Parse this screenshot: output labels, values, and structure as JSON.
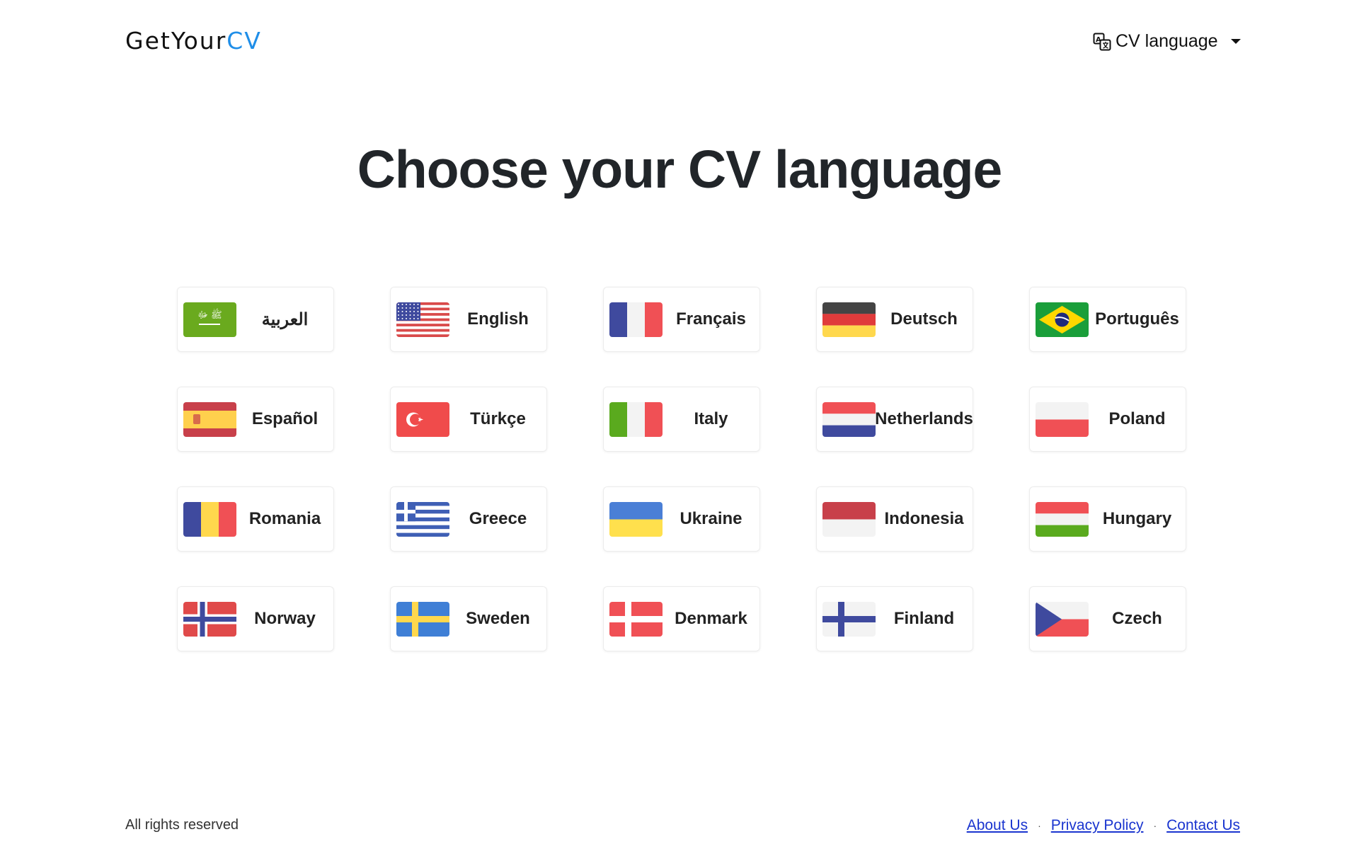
{
  "header": {
    "logo_part1": "GetYour",
    "logo_part2": "CV",
    "language_button_label": "CV language",
    "language_icon": "translate-icon"
  },
  "main": {
    "title": "Choose your CV language",
    "languages": [
      {
        "label": "العربية",
        "flag": "saudi-arabia-flag"
      },
      {
        "label": "English",
        "flag": "usa-flag"
      },
      {
        "label": "Français",
        "flag": "france-flag"
      },
      {
        "label": "Deutsch",
        "flag": "germany-flag"
      },
      {
        "label": "Português",
        "flag": "brazil-flag"
      },
      {
        "label": "Español",
        "flag": "spain-flag"
      },
      {
        "label": "Türkçe",
        "flag": "turkey-flag"
      },
      {
        "label": "Italy",
        "flag": "italy-flag"
      },
      {
        "label": "Netherlands",
        "flag": "netherlands-flag"
      },
      {
        "label": "Poland",
        "flag": "poland-flag"
      },
      {
        "label": "Romania",
        "flag": "romania-flag"
      },
      {
        "label": "Greece",
        "flag": "greece-flag"
      },
      {
        "label": "Ukraine",
        "flag": "ukraine-flag"
      },
      {
        "label": "Indonesia",
        "flag": "indonesia-flag"
      },
      {
        "label": "Hungary",
        "flag": "hungary-flag"
      },
      {
        "label": "Norway",
        "flag": "norway-flag"
      },
      {
        "label": "Sweden",
        "flag": "sweden-flag"
      },
      {
        "label": "Denmark",
        "flag": "denmark-flag"
      },
      {
        "label": "Finland",
        "flag": "finland-flag"
      },
      {
        "label": "Czech",
        "flag": "czech-flag"
      }
    ]
  },
  "footer": {
    "rights": "All rights reserved",
    "links": [
      "About Us",
      "Privacy Policy",
      "Contact Us"
    ],
    "separator": "·"
  },
  "colors": {
    "logo_accent": "#1f8ee8",
    "link": "#1a35cf",
    "title": "#212529"
  }
}
